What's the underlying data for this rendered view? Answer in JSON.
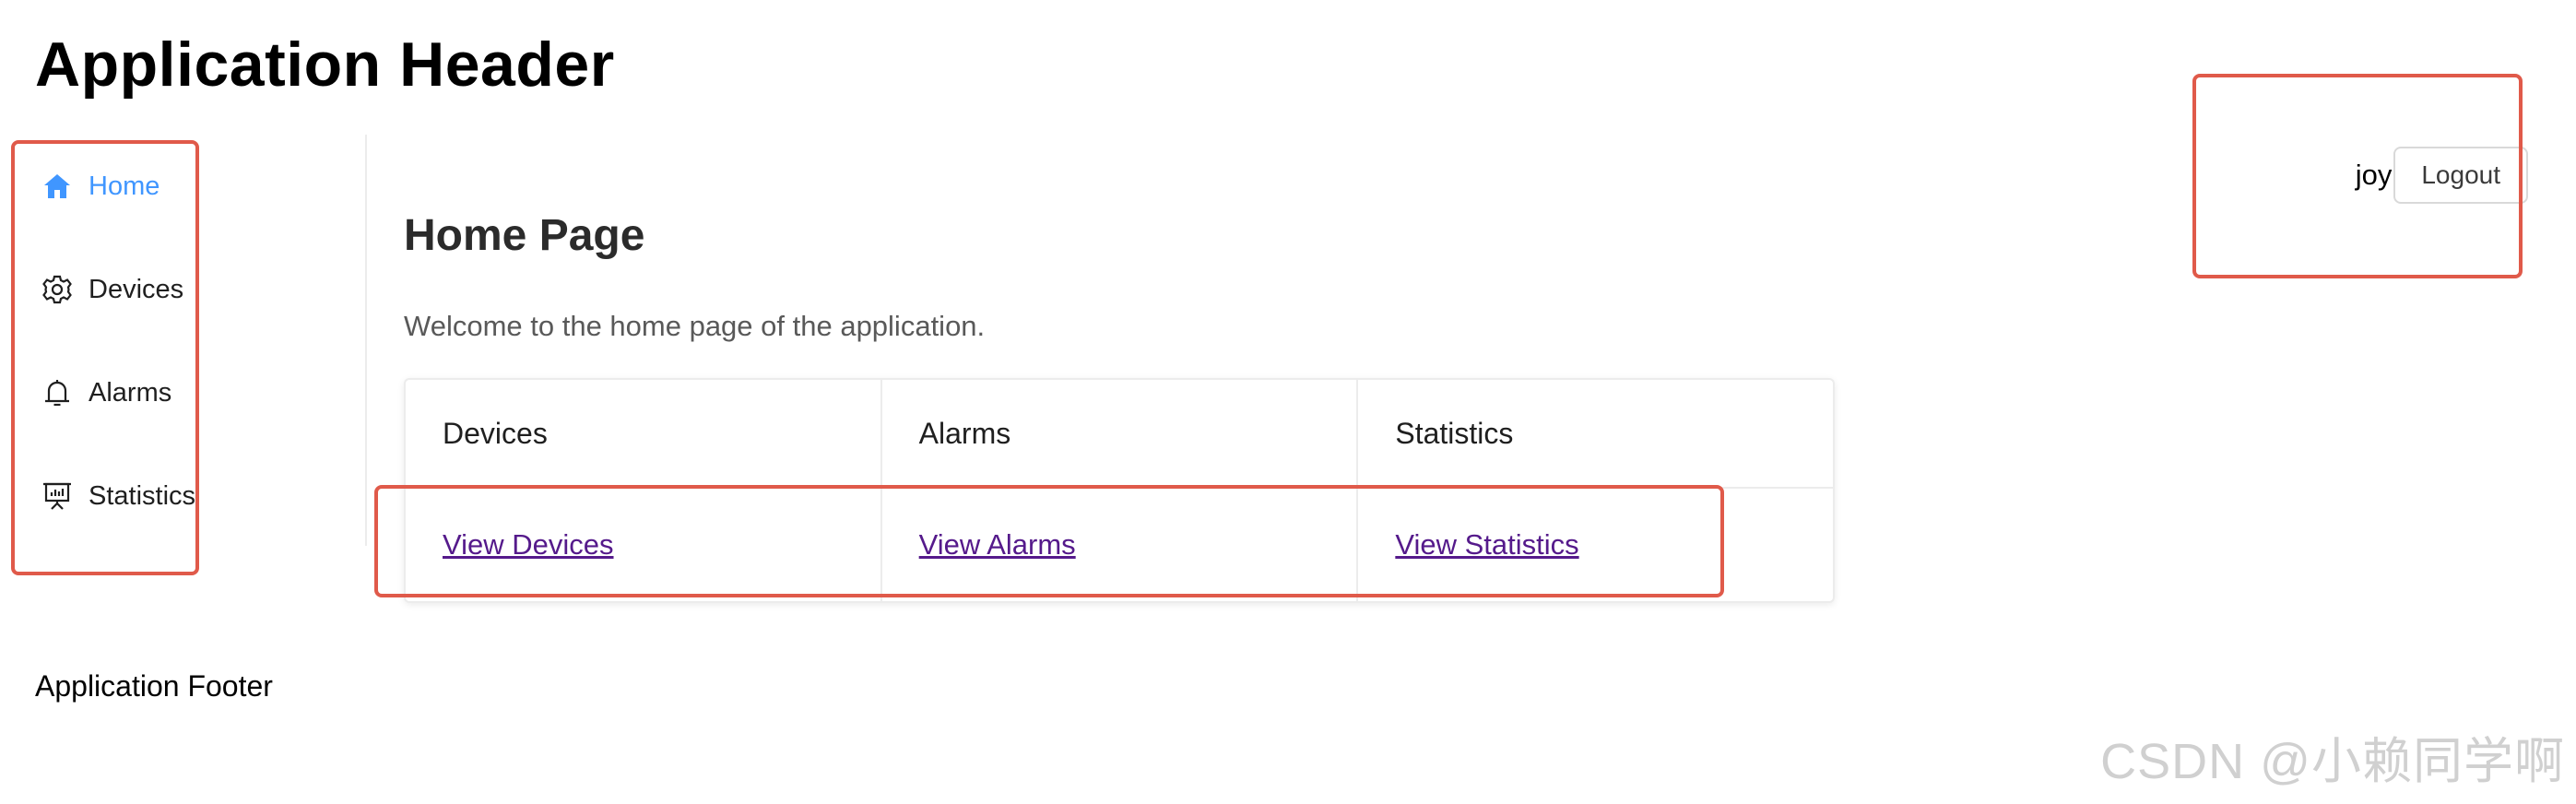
{
  "header": {
    "title": "Application Header"
  },
  "sidebar": {
    "items": [
      {
        "label": "Home",
        "icon": "home-icon",
        "active": true
      },
      {
        "label": "Devices",
        "icon": "gear-icon",
        "active": false
      },
      {
        "label": "Alarms",
        "icon": "bell-icon",
        "active": false
      },
      {
        "label": "Statistics",
        "icon": "presentation-chart-icon",
        "active": false
      }
    ]
  },
  "main": {
    "title": "Home Page",
    "welcome": "Welcome to the home page of the application.",
    "cards": [
      {
        "title": "Devices",
        "link": "View Devices"
      },
      {
        "title": "Alarms",
        "link": "View Alarms"
      },
      {
        "title": "Statistics",
        "link": "View Statistics"
      }
    ]
  },
  "user": {
    "name": "joy",
    "logout_label": "Logout"
  },
  "footer": {
    "text": "Application Footer"
  },
  "watermark": {
    "text": "CSDN @小赖同学啊"
  },
  "colors": {
    "accent": "#4096ff",
    "annotation_red": "#e05a4a",
    "visited_link": "#551a8b"
  }
}
